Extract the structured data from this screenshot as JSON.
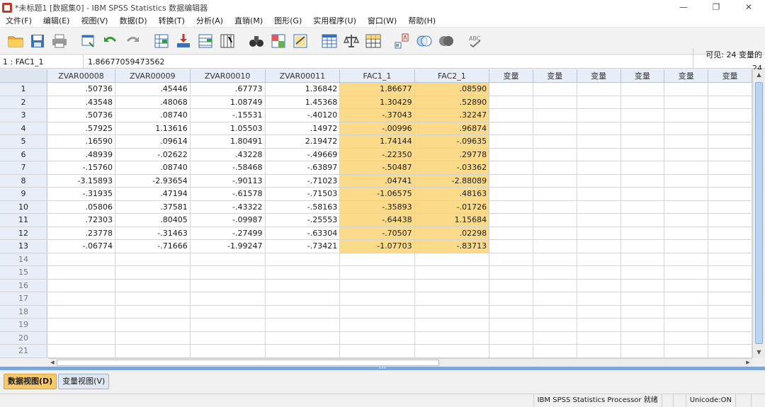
{
  "window": {
    "title": "*未标题1 [数据集0] - IBM SPSS Statistics 数据编辑器",
    "minimize": "—",
    "restore": "❐",
    "close": "✕"
  },
  "menus": [
    "文件(F)",
    "编辑(E)",
    "视图(V)",
    "数据(D)",
    "转换(T)",
    "分析(A)",
    "直销(M)",
    "图形(G)",
    "实用程序(U)",
    "窗口(W)",
    "帮助(H)"
  ],
  "toolbar_icons": [
    "open-folder-icon",
    "save-icon",
    "print-icon",
    "dialog-recall-icon",
    "undo-icon",
    "redo-icon",
    "goto-case-icon",
    "goto-variable-icon",
    "variables-icon",
    "run-descriptives-icon",
    "find-icon",
    "insert-cases-icon",
    "insert-variable-icon",
    "split-file-icon",
    "weight-cases-icon",
    "select-cases-icon",
    "value-labels-icon",
    "use-sets-icon",
    "spell-check-icon"
  ],
  "cell_editor": {
    "ref": "1 : FAC1_1",
    "value": "1.86677059473562",
    "visible": "可见:  24 变量的 24"
  },
  "grid": {
    "columns": [
      "ZVAR00008",
      "ZVAR00009",
      "ZVAR00010",
      "ZVAR00011",
      "FAC1_1",
      "FAC2_1",
      "变量",
      "变量",
      "变量",
      "变量",
      "变量",
      "变量"
    ],
    "highlight_columns": [
      4,
      5
    ],
    "highlight_color": "#fbdb8a",
    "rows": [
      {
        "n": "1",
        "cells": [
          ".50736",
          ".45446",
          ".67773",
          "1.36842",
          "1.86677",
          ".08590"
        ]
      },
      {
        "n": "2",
        "cells": [
          ".43548",
          ".48068",
          "1.08749",
          "1.45368",
          "1.30429",
          ".52890"
        ]
      },
      {
        "n": "3",
        "cells": [
          ".50736",
          ".08740",
          "-.15531",
          "-.40120",
          "-.37043",
          ".32247"
        ]
      },
      {
        "n": "4",
        "cells": [
          ".57925",
          "1.13616",
          "1.05503",
          ".14972",
          "-.00996",
          ".96874"
        ]
      },
      {
        "n": "5",
        "cells": [
          ".16590",
          ".09614",
          "1.80491",
          "2.19472",
          "1.74144",
          "-.09635"
        ]
      },
      {
        "n": "6",
        "cells": [
          ".48939",
          "-.02622",
          ".43228",
          "-.49669",
          "-.22350",
          ".29778"
        ]
      },
      {
        "n": "7",
        "cells": [
          "-.15760",
          ".08740",
          "-.58468",
          "-.63897",
          "-.50487",
          "-.03362"
        ]
      },
      {
        "n": "8",
        "cells": [
          "-3.15893",
          "-2.93654",
          "-.90113",
          "-.71023",
          ".04741",
          "-2.88089"
        ]
      },
      {
        "n": "9",
        "cells": [
          "-.31935",
          ".47194",
          "-.61578",
          "-.71503",
          "-1.06575",
          ".48163"
        ]
      },
      {
        "n": "10",
        "cells": [
          ".05806",
          ".37581",
          "-.43322",
          "-.58163",
          "-.35893",
          "-.01726"
        ]
      },
      {
        "n": "11",
        "cells": [
          ".72303",
          ".80405",
          "-.09987",
          "-.25553",
          "-.64438",
          "1.15684"
        ]
      },
      {
        "n": "12",
        "cells": [
          ".23778",
          "-.31463",
          "-.27499",
          "-.63304",
          "-.70507",
          ".02298"
        ]
      },
      {
        "n": "13",
        "cells": [
          "-.06774",
          "-.71666",
          "-1.99247",
          "-.73421",
          "-1.07703",
          "-.83713"
        ]
      },
      {
        "n": "14",
        "cells": []
      },
      {
        "n": "15",
        "cells": []
      },
      {
        "n": "16",
        "cells": []
      },
      {
        "n": "17",
        "cells": []
      },
      {
        "n": "18",
        "cells": []
      },
      {
        "n": "19",
        "cells": []
      },
      {
        "n": "20",
        "cells": []
      },
      {
        "n": "21",
        "cells": []
      }
    ]
  },
  "tabs": [
    {
      "label": "数据视图(D)",
      "active": true
    },
    {
      "label": "变量视图(V)",
      "active": false
    }
  ],
  "status": {
    "processor": "IBM SPSS Statistics Processor 就绪",
    "unicode": "Unicode:ON"
  }
}
